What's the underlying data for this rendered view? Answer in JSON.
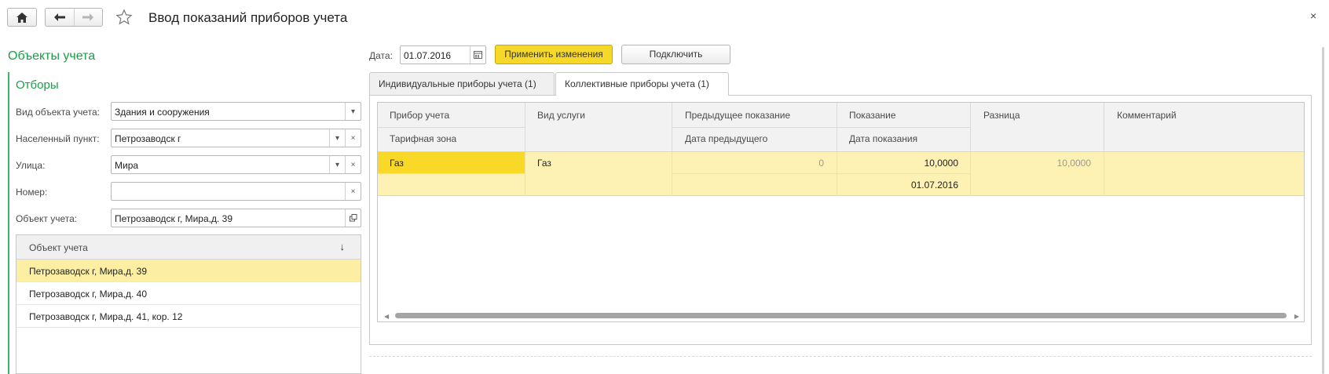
{
  "header": {
    "title": "Ввод показаний приборов учета",
    "close_label": "×"
  },
  "left": {
    "section_title": "Объекты учета",
    "filters_title": "Отборы",
    "fields": {
      "object_type": {
        "label": "Вид объекта учета:",
        "value": "Здания и сооружения"
      },
      "locality": {
        "label": "Населенный пункт:",
        "value": "Петрозаводск г"
      },
      "street": {
        "label": "Улица:",
        "value": "Мира"
      },
      "number": {
        "label": "Номер:",
        "value": ""
      },
      "object": {
        "label": "Объект учета:",
        "value": "Петрозаводск г, Мира,д. 39"
      }
    },
    "list": {
      "header": "Объект учета",
      "sort_arrow": "↓",
      "items": [
        "Петрозаводск г, Мира,д. 39",
        "Петрозаводск г, Мира,д. 40",
        "Петрозаводск г, Мира,д. 41, кор. 12"
      ],
      "selected_index": 0
    }
  },
  "right": {
    "date_label": "Дата:",
    "date_value": "01.07.2016",
    "apply_button": "Применить изменения",
    "connect_button": "Подключить",
    "tabs": [
      {
        "label": "Индивидуальные приборы учета (1)",
        "active": false
      },
      {
        "label": "Коллективные приборы учета (1)",
        "active": true
      }
    ],
    "grid": {
      "columns": {
        "device": {
          "top": "Прибор учета",
          "bottom": "Тарифная зона"
        },
        "service": {
          "top": "Вид услуги"
        },
        "prev_reading": {
          "top": "Предыдущее показание",
          "bottom": "Дата предыдущего"
        },
        "reading": {
          "top": "Показание",
          "bottom": "Дата показания"
        },
        "difference": {
          "top": "Разница"
        },
        "comment": {
          "top": "Комментарий"
        }
      },
      "rows": [
        {
          "device": "Газ",
          "tariff_zone": "",
          "service": "Газ",
          "prev_reading": "0",
          "prev_date": "",
          "reading": "10,0000",
          "reading_date": "01.07.2016",
          "difference": "10,0000",
          "comment": ""
        }
      ]
    }
  },
  "colors": {
    "accent_green": "#1a9e48",
    "selected_row": "#fdf2b3",
    "primary_button": "#f5d829",
    "selected_cell": "#f9d928"
  }
}
